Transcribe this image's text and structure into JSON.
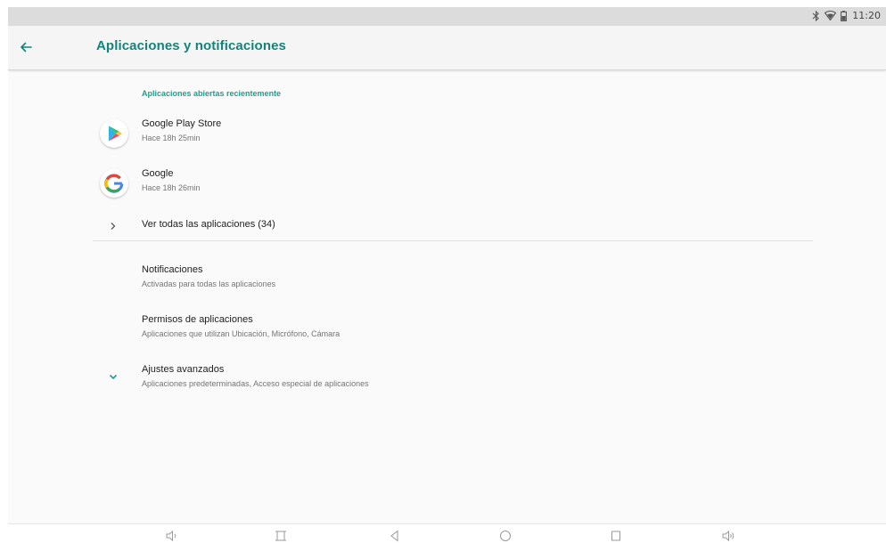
{
  "status_bar": {
    "time": "11:20",
    "icons": [
      "bluetooth-icon",
      "wifi-icon",
      "battery-icon"
    ]
  },
  "app_bar": {
    "title": "Aplicaciones y notificaciones",
    "back_icon": "arrow-back-icon"
  },
  "recent_apps": {
    "header": "Aplicaciones abiertas recientemente",
    "items": [
      {
        "title": "Google Play Store",
        "subtitle": "Hace 18h 25min",
        "icon": "play-store-icon"
      },
      {
        "title": "Google",
        "subtitle": "Hace 18h 26min",
        "icon": "google-g-icon"
      }
    ],
    "see_all": {
      "label": "Ver todas las aplicaciones (34)",
      "icon": "chevron-right-icon"
    }
  },
  "settings": [
    {
      "title": "Notificaciones",
      "subtitle": "Activadas para todas las aplicaciones"
    },
    {
      "title": "Permisos de aplicaciones",
      "subtitle": "Aplicaciones que utilizan Ubicación, Micrófono, Cámara"
    },
    {
      "title": "Ajustes avanzados",
      "subtitle": "Aplicaciones predeterminadas, Acceso especial de aplicaciones",
      "icon": "chevron-down-icon"
    }
  ],
  "nav_bar": {
    "buttons": [
      "volume-down-icon",
      "screenshot-icon",
      "back-triangle-icon",
      "home-circle-icon",
      "recents-square-icon",
      "volume-up-icon"
    ]
  },
  "colors": {
    "accent": "#138479",
    "section_header": "#1e9e8e",
    "background": "#fafafa",
    "status_bar": "#dcdcdc"
  }
}
